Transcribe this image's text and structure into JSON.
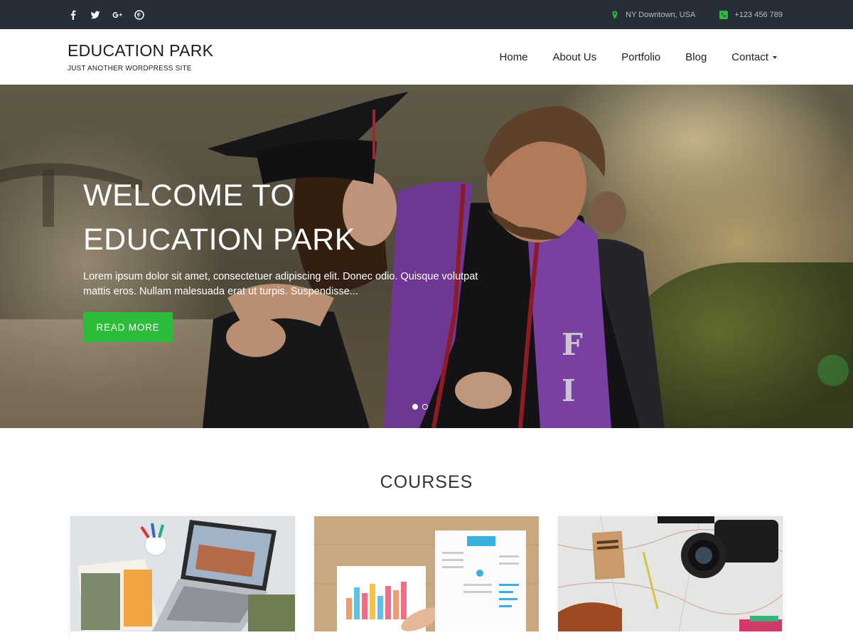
{
  "topbar": {
    "social_icons": [
      "facebook-icon",
      "twitter-icon",
      "google-plus-icon",
      "pinterest-icon"
    ],
    "location": "NY Downtown, USA",
    "phone": "+123 456 789",
    "icon_color": "#2dbb3a"
  },
  "header": {
    "site_title": "EDUCATION PARK",
    "tagline": "JUST ANOTHER WORDPRESS SITE",
    "nav": [
      {
        "label": "Home"
      },
      {
        "label": "About Us"
      },
      {
        "label": "Portfolio"
      },
      {
        "label": "Blog"
      },
      {
        "label": "Contact"
      }
    ]
  },
  "hero": {
    "title_line1": "WELCOME TO",
    "title_line2": "EDUCATION PARK",
    "text": "Lorem ipsum dolor sit amet, consectetuer adipiscing elit. Donec odio. Quisque volutpat mattis eros. Nullam malesuada erat ut turpis. Suspendisse...",
    "button_label": "READ MORE",
    "button_color": "#2dbb3a",
    "slides": 2,
    "active_slide": 1
  },
  "courses": {
    "title": "COURSES"
  },
  "colors": {
    "topbar_bg": "#282d3a",
    "accent": "#2dbb3a"
  }
}
